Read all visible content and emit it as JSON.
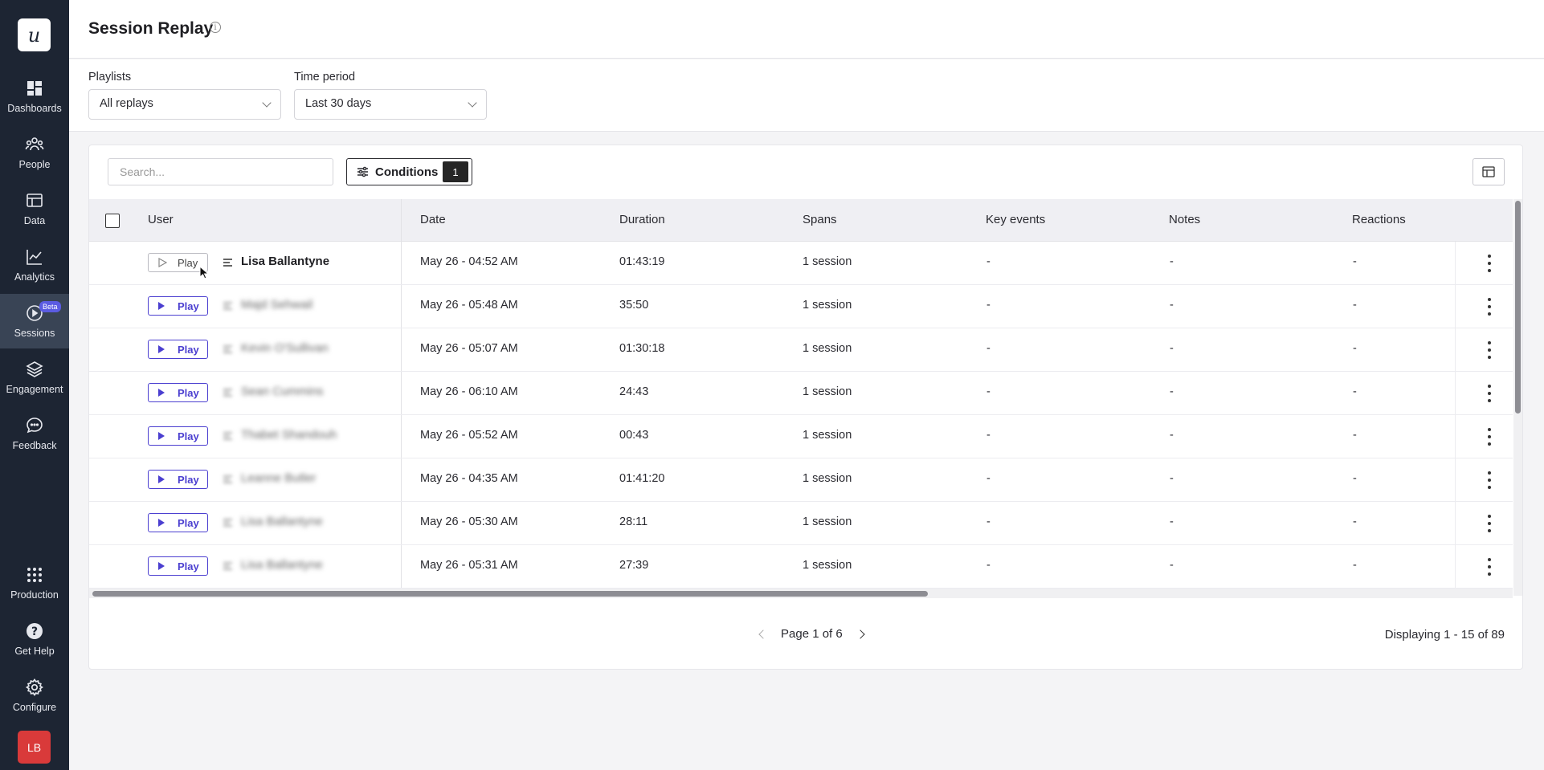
{
  "sidebar": {
    "logo": "u",
    "items": [
      {
        "label": "Dashboards",
        "icon": "dashboards-icon"
      },
      {
        "label": "People",
        "icon": "people-icon"
      },
      {
        "label": "Data",
        "icon": "data-icon"
      },
      {
        "label": "Analytics",
        "icon": "analytics-icon"
      },
      {
        "label": "Sessions",
        "icon": "play-circle-icon",
        "badge": "Beta",
        "active": true
      },
      {
        "label": "Engagement",
        "icon": "layers-icon"
      },
      {
        "label": "Feedback",
        "icon": "chat-bubble-icon"
      },
      {
        "label": "Production",
        "icon": "grid-icon"
      },
      {
        "label": "Get Help",
        "icon": "help-icon"
      },
      {
        "label": "Configure",
        "icon": "gear-icon"
      }
    ],
    "avatar": "LB"
  },
  "header": {
    "title": "Session Replay",
    "info_icon": "i"
  },
  "filters": {
    "playlists_label": "Playlists",
    "playlists_value": "All replays",
    "time_label": "Time period",
    "time_value": "Last 30 days"
  },
  "toolbar": {
    "search_placeholder": "Search...",
    "conditions_label": "Conditions",
    "conditions_count": "1"
  },
  "table": {
    "columns": [
      "User",
      "Date",
      "Duration",
      "Spans",
      "Key events",
      "Notes",
      "Reactions"
    ],
    "play_label": "Play",
    "rows": [
      {
        "user": "Lisa Ballantyne",
        "blurred": false,
        "date": "May 26 - 04:52 AM",
        "duration": "01:43:19",
        "spans": "1 session",
        "key_events": "-",
        "notes": "-",
        "reactions": "-"
      },
      {
        "user": "Majd Sehwail",
        "blurred": true,
        "date": "May 26 - 05:48 AM",
        "duration": "35:50",
        "spans": "1 session",
        "key_events": "-",
        "notes": "-",
        "reactions": "-"
      },
      {
        "user": "Kevin O'Sullivan",
        "blurred": true,
        "date": "May 26 - 05:07 AM",
        "duration": "01:30:18",
        "spans": "1 session",
        "key_events": "-",
        "notes": "-",
        "reactions": "-"
      },
      {
        "user": "Sean Cummins",
        "blurred": true,
        "date": "May 26 - 06:10 AM",
        "duration": "24:43",
        "spans": "1 session",
        "key_events": "-",
        "notes": "-",
        "reactions": "-"
      },
      {
        "user": "Thabet Shandouh",
        "blurred": true,
        "date": "May 26 - 05:52 AM",
        "duration": "00:43",
        "spans": "1 session",
        "key_events": "-",
        "notes": "-",
        "reactions": "-"
      },
      {
        "user": "Leanne Butler",
        "blurred": true,
        "date": "May 26 - 04:35 AM",
        "duration": "01:41:20",
        "spans": "1 session",
        "key_events": "-",
        "notes": "-",
        "reactions": "-"
      },
      {
        "user": "Lisa Ballantyne",
        "blurred": true,
        "date": "May 26 - 05:30 AM",
        "duration": "28:11",
        "spans": "1 session",
        "key_events": "-",
        "notes": "-",
        "reactions": "-"
      },
      {
        "user": "Lisa Ballantyne",
        "blurred": true,
        "date": "May 26 - 05:31 AM",
        "duration": "27:39",
        "spans": "1 session",
        "key_events": "-",
        "notes": "-",
        "reactions": "-"
      }
    ]
  },
  "pagination": {
    "page_text": "Page 1 of 6",
    "displaying": "Displaying 1 - 15 of 89"
  },
  "colors": {
    "sidebar_bg": "#1d2533",
    "accent": "#4b3fd0",
    "avatar_bg": "#d93a3a",
    "beta_badge": "#5b5ce2"
  }
}
